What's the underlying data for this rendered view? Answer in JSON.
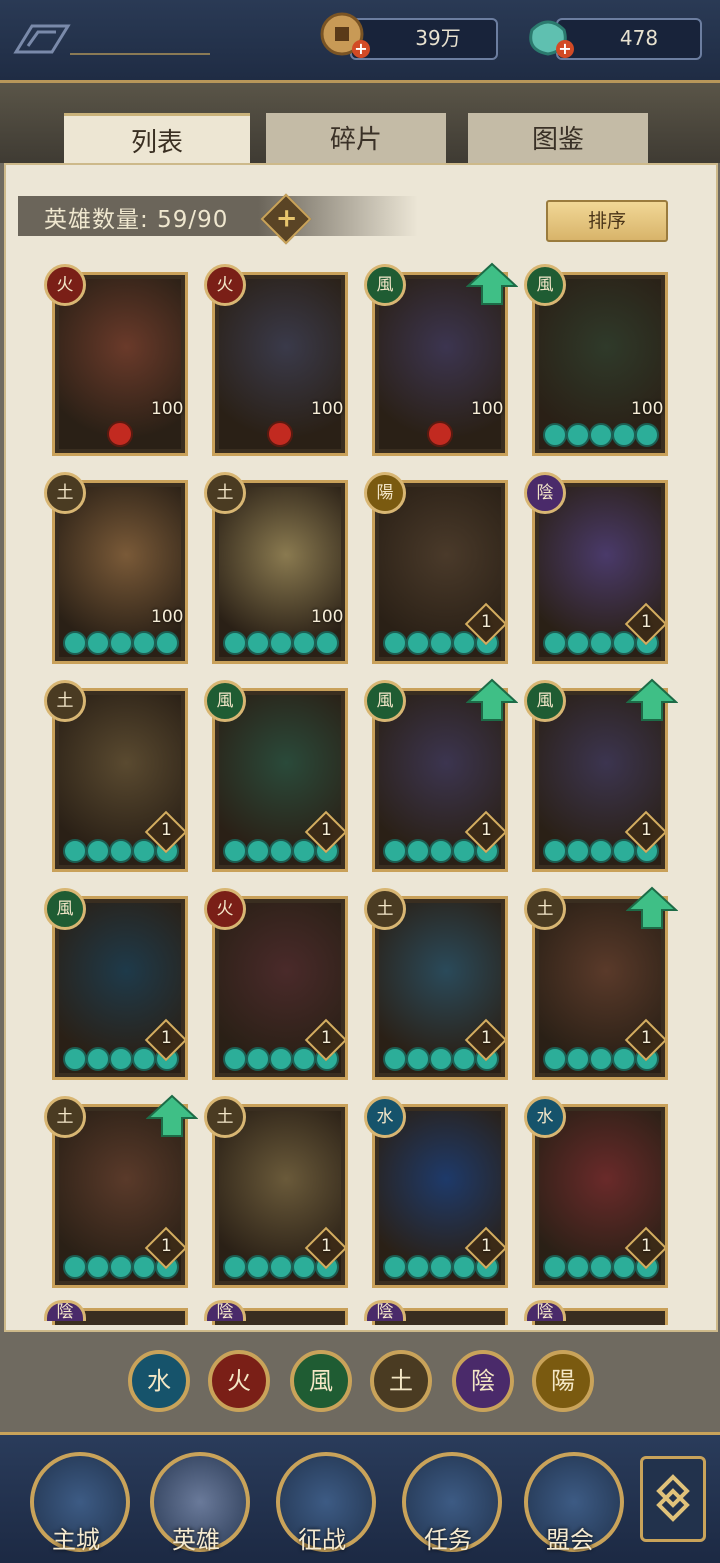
{
  "resources": {
    "copper_value": "39万",
    "jade_value": "478",
    "copper_icon": "copper-coin-icon",
    "jade_icon": "jade-bag-icon"
  },
  "tabs": [
    {
      "label": "列表",
      "active": true
    },
    {
      "label": "碎片",
      "active": false
    },
    {
      "label": "图鉴",
      "active": false
    }
  ],
  "hero_count": {
    "label": "英雄数量:",
    "value": "59/90"
  },
  "sort_button": "排序",
  "elements": {
    "fire": {
      "glyph": "火",
      "color": "#7a1f17"
    },
    "wind": {
      "glyph": "風",
      "color": "#1f5c33"
    },
    "earth": {
      "glyph": "土",
      "color": "#4a3b22"
    },
    "yang": {
      "glyph": "陽",
      "color": "#7a5a10"
    },
    "yin": {
      "glyph": "陰",
      "color": "#4a2a6a"
    },
    "water": {
      "glyph": "水",
      "color": "#16536b"
    }
  },
  "heroes": [
    {
      "element": "fire",
      "level": "100",
      "badge": "flame",
      "upgrade": false,
      "art": "#6a3a2a"
    },
    {
      "element": "fire",
      "level": "100",
      "badge": "flame",
      "upgrade": false,
      "art": "#3a3a4a"
    },
    {
      "element": "wind",
      "level": "100",
      "badge": "flame",
      "upgrade": true,
      "art": "#3c3550"
    },
    {
      "element": "wind",
      "level": "100",
      "badge": "orbs",
      "upgrade": false,
      "art": "#2f3a2a"
    },
    {
      "element": "earth",
      "level": "100",
      "badge": "orbs",
      "upgrade": false,
      "art": "#7a5a38"
    },
    {
      "element": "earth",
      "level": "100",
      "badge": "orbs",
      "upgrade": false,
      "art": "#8a7a50"
    },
    {
      "element": "yang",
      "level": "1",
      "badge": "orbs",
      "upgrade": false,
      "art": "#4a3a2a"
    },
    {
      "element": "yin",
      "level": "1",
      "badge": "orbs",
      "upgrade": false,
      "art": "#4a3a6a"
    },
    {
      "element": "earth",
      "level": "1",
      "badge": "orbs",
      "upgrade": false,
      "art": "#5a4a30"
    },
    {
      "element": "wind",
      "level": "1",
      "badge": "orbs",
      "upgrade": false,
      "art": "#2a4a3a"
    },
    {
      "element": "wind",
      "level": "1",
      "badge": "orbs",
      "upgrade": true,
      "art": "#3c3550"
    },
    {
      "element": "wind",
      "level": "1",
      "badge": "orbs",
      "upgrade": true,
      "art": "#3c3550"
    },
    {
      "element": "wind",
      "level": "1",
      "badge": "orbs",
      "upgrade": false,
      "art": "#1e3a4a"
    },
    {
      "element": "fire",
      "level": "1",
      "badge": "orbs",
      "upgrade": false,
      "art": "#4a2a2a"
    },
    {
      "element": "earth",
      "level": "1",
      "badge": "orbs",
      "upgrade": false,
      "art": "#2a4a5a"
    },
    {
      "element": "earth",
      "level": "1",
      "badge": "orbs",
      "upgrade": true,
      "art": "#5a3a2a"
    },
    {
      "element": "earth",
      "level": "1",
      "badge": "orbs",
      "upgrade": true,
      "art": "#5a3a2a"
    },
    {
      "element": "earth",
      "level": "1",
      "badge": "orbs",
      "upgrade": false,
      "art": "#6a5a3a"
    },
    {
      "element": "water",
      "level": "1",
      "badge": "orbs",
      "upgrade": false,
      "art": "#1e3a6a"
    },
    {
      "element": "water",
      "level": "1",
      "badge": "orbs",
      "upgrade": false,
      "art": "#6a2a2a"
    }
  ],
  "partial_row_elements": [
    "yin",
    "yin",
    "yin",
    "yin"
  ],
  "filters": [
    {
      "element": "water"
    },
    {
      "element": "fire"
    },
    {
      "element": "wind"
    },
    {
      "element": "earth"
    },
    {
      "element": "yin"
    },
    {
      "element": "yang"
    }
  ],
  "nav": [
    {
      "label": "主城",
      "icon": "city-gate-icon"
    },
    {
      "label": "英雄",
      "icon": "hero-portrait-icon"
    },
    {
      "label": "征战",
      "icon": "battle-icon"
    },
    {
      "label": "任务",
      "icon": "quest-scroll-icon"
    },
    {
      "label": "盟会",
      "icon": "guild-pavilion-icon"
    }
  ],
  "side_menu_icon": "menu-knot-icon"
}
